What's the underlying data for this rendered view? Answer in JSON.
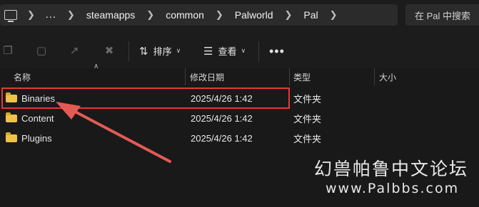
{
  "address_bar": {
    "breadcrumbs": [
      "steamapps",
      "common",
      "Palworld",
      "Pal"
    ],
    "overflow": "…"
  },
  "search": {
    "placeholder": "在 Pal 中搜索"
  },
  "toolbar": {
    "sort_label": "排序",
    "view_label": "查看",
    "more_label": "•••"
  },
  "columns": {
    "name": "名称",
    "modified": "修改日期",
    "type": "类型",
    "size": "大小"
  },
  "rows": [
    {
      "name": "Binaries",
      "modified": "2025/4/26 1:42",
      "type": "文件夹",
      "size": ""
    },
    {
      "name": "Content",
      "modified": "2025/4/26 1:42",
      "type": "文件夹",
      "size": ""
    },
    {
      "name": "Plugins",
      "modified": "2025/4/26 1:42",
      "type": "文件夹",
      "size": ""
    }
  ],
  "annotation": {
    "highlight_color": "#e53935",
    "arrow_color": "#e45b55"
  },
  "watermark": {
    "title": "幻兽帕鲁中文论坛",
    "url": "www.Palbbs.com"
  },
  "colors": {
    "background": "#191919",
    "folder": "#f0c24a"
  }
}
